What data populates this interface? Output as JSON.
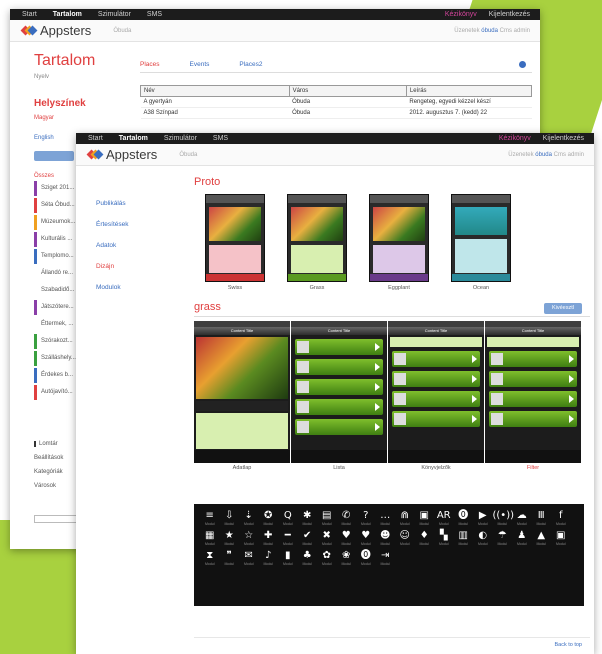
{
  "colors": {
    "green": "#a8d13f",
    "red": "#e04040",
    "blue": "#3a6dbf",
    "pink": "#d2449a",
    "dark": "#1c1c1c"
  },
  "back": {
    "nav": [
      "Start",
      "Tartalom",
      "Szimulátor",
      "SMS"
    ],
    "nav_right": [
      "Kézikönyv",
      "Kijelentkezés"
    ],
    "logo": "Appsters",
    "city": "Óbuda",
    "user": {
      "prefix": "Üzenetek",
      "place": "óbuda",
      "name": "Cms admin"
    },
    "title": "Tartalom",
    "lang_label": "Nyelv",
    "places_title": "Helyszínek",
    "lang_magyar": "Magyar",
    "lang_english": "English",
    "osszes": "Összes",
    "categories": [
      "Sziget 201...",
      "Séta Óbud...",
      "Múzeumok...",
      "Kulturális ...",
      "Templomo...",
      "Állandó re...",
      "Szabadidő...",
      "Játszótere...",
      "Éttermek, ...",
      "Szórakozt...",
      "Szálláshely...",
      "Érdekes b...",
      "Autójavító..."
    ],
    "bottom_links": [
      "Lomtár",
      "Beállítások",
      "Kategóriák",
      "Városok"
    ],
    "tabs": [
      "Places",
      "Events",
      "Places2"
    ],
    "table_headers": [
      "Név",
      "Város",
      "Leírás"
    ],
    "rows": [
      [
        "A gyertyán",
        "Óbuda",
        "Rengeteg, egyedi kézzel készí"
      ],
      [
        "A38 Színpad",
        "Óbuda",
        "2012. augusztus 7. (kedd) 22"
      ]
    ]
  },
  "front": {
    "nav": [
      "Start",
      "Tartalom",
      "Szimulátor",
      "SMS"
    ],
    "nav_right": [
      "Kézikönyv",
      "Kijelentkezés"
    ],
    "logo": "Appsters",
    "city": "Óbuda",
    "user": {
      "prefix": "Üzenetek",
      "place": "óbuda",
      "name": "Cms admin"
    },
    "menu": [
      "Publikálás",
      "Értesítések",
      "Adatok",
      "Dizájn",
      "Modulok"
    ],
    "proto_title": "Proto",
    "protos": [
      "Swiss",
      "Grass",
      "Eggplant",
      "Ocean"
    ],
    "grass_title": "grass",
    "grass_button": "Kivéesztl",
    "grass_screens": [
      "Adatlap",
      "Lista",
      "Könyvjelzők",
      "Filter"
    ],
    "screen_header": "Content Title",
    "icon_caption": "Modul",
    "icons": [
      "≡",
      "⇩",
      "⇣",
      "✪",
      "Q",
      "✱",
      "▤",
      "✆",
      "?",
      "…",
      "⋒",
      "▣",
      "AR",
      "⓿",
      "▶",
      "((•))",
      "☁",
      "Ⅲ",
      "f",
      "▦",
      "★",
      "☆",
      "✚",
      "━",
      "✔",
      "✖",
      "♥",
      "♥",
      "☻",
      "☺",
      "♦",
      "▚",
      "▥",
      "◐",
      "☂",
      "♟",
      "▲",
      "▣",
      "⧗",
      "❞",
      "✉",
      "♪",
      "▮",
      "♣",
      "✿",
      "❀",
      "⓿",
      "⇥"
    ],
    "back_to_top": "Back to top"
  }
}
